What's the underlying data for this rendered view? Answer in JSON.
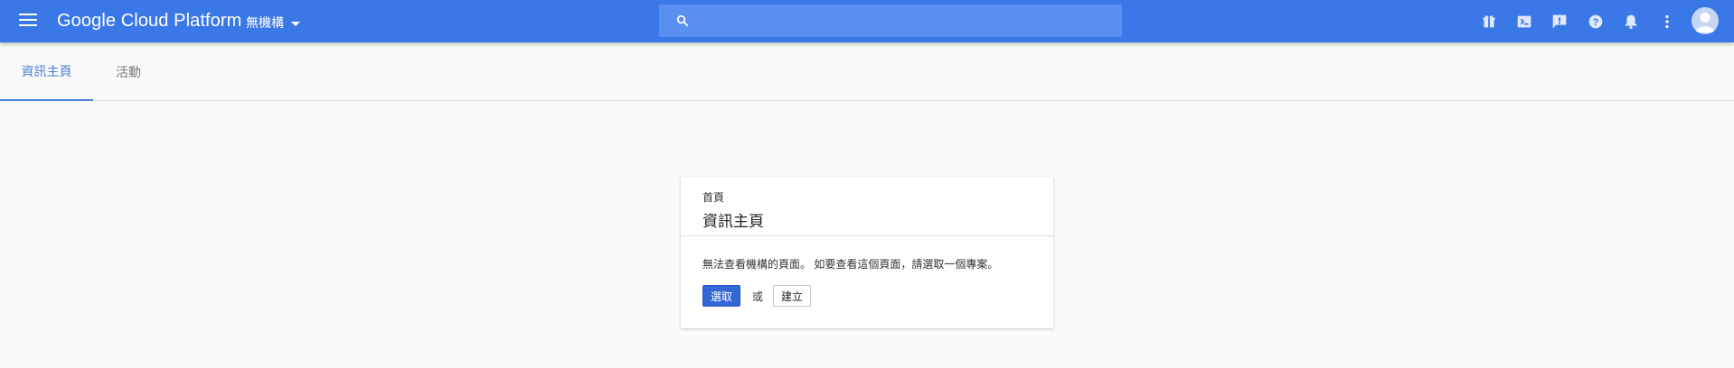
{
  "header": {
    "brand": "Google Cloud Platform",
    "org_selector": "無機構",
    "search": {
      "value": "",
      "placeholder": ""
    },
    "icons": [
      "gift-icon",
      "cloud-shell-icon",
      "feedback-icon",
      "help-icon",
      "notifications-icon",
      "more-vert-icon",
      "account-avatar-icon"
    ]
  },
  "tabs": [
    {
      "label": "資訊主頁",
      "active": true
    },
    {
      "label": "活動",
      "active": false
    }
  ],
  "card": {
    "breadcrumb": "首頁",
    "title": "資訊主頁",
    "message": "無法查看機構的頁面。 如要查看這個頁面，請選取一個專案。",
    "select_button": "選取",
    "or_text": "或",
    "create_button": "建立"
  },
  "colors": {
    "topbar": "#3b78e7",
    "accent": "#4a7fd6",
    "primary_button": "#3367d6",
    "background": "#fafafa"
  }
}
